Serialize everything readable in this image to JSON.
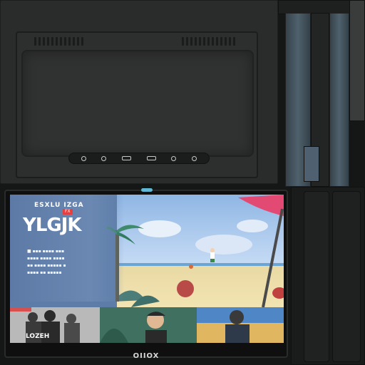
{
  "device": {
    "bottom_label": "OIIOX",
    "ports": [
      "circle-port",
      "circle-port",
      "usb-port",
      "usb-port",
      "circle-port",
      "circle-port"
    ]
  },
  "screen": {
    "brand_small": "ESXLU IZGA",
    "badge": "FX",
    "title": "YLGJK",
    "meta_lines": [
      "■ ▪▪▪ ▪▪▪▪ ▪▪▪",
      "▪▪▪▪ ▪▪▪▪ ▪▪▪▪",
      "▪▪ ▪▪▪▪ ▪▪▪▪▪ ▪",
      "▪▪▪▪ ▪▪ ▪▪▪▪▪"
    ],
    "thumbnails": [
      {
        "label": "LOZEH"
      },
      {
        "label": ""
      },
      {
        "label": ""
      }
    ]
  },
  "colors": {
    "accent_led": "#5fb8d6",
    "badge_red": "#e54040",
    "screen_blue": "#5d7da8",
    "parasol_pink": "#e24a73"
  }
}
